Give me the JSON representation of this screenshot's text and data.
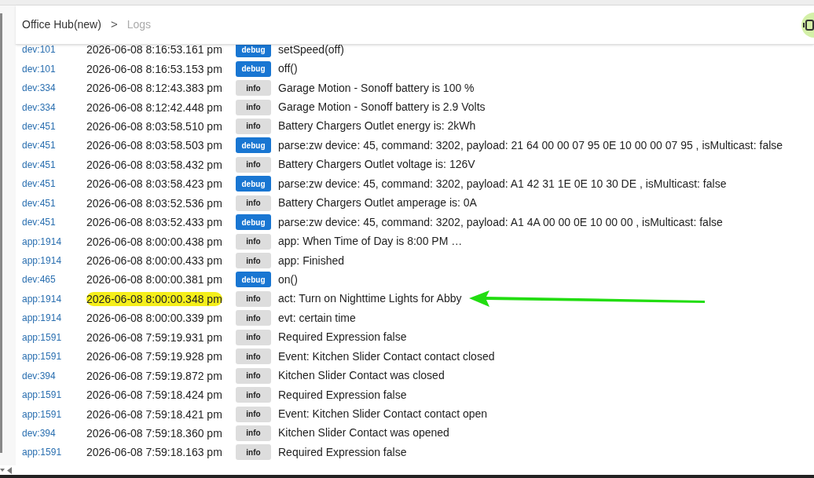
{
  "breadcrumb": {
    "hub": "Office Hub(new)",
    "separator": ">",
    "page": "Logs"
  },
  "rows": [
    {
      "source": "dev:101",
      "time": "2026-06-08 8:16:53.161 pm",
      "kind": "debug",
      "badge": "debug",
      "message": "setSpeed(off)",
      "annotated": false
    },
    {
      "source": "dev:101",
      "time": "2026-06-08 8:16:53.153 pm",
      "kind": "debug",
      "badge": "debug",
      "message": "off()",
      "annotated": false
    },
    {
      "source": "dev:334",
      "time": "2026-06-08 8:12:43.383 pm",
      "kind": "info",
      "badge": "info",
      "message": "Garage Motion - Sonoff battery is 100 %",
      "annotated": false
    },
    {
      "source": "dev:334",
      "time": "2026-06-08 8:12:42.448 pm",
      "kind": "info",
      "badge": "info",
      "message": "Garage Motion - Sonoff battery is 2.9 Volts",
      "annotated": false
    },
    {
      "source": "dev:451",
      "time": "2026-06-08 8:03:58.510 pm",
      "kind": "info",
      "badge": "info",
      "message": "Battery Chargers Outlet energy is: 2kWh",
      "annotated": false
    },
    {
      "source": "dev:451",
      "time": "2026-06-08 8:03:58.503 pm",
      "kind": "debug",
      "badge": "debug",
      "message": "parse:zw device: 45, command: 3202, payload: 21 64 00 00 07 95 0E 10 00 00 07 95 , isMulticast: false",
      "annotated": false
    },
    {
      "source": "dev:451",
      "time": "2026-06-08 8:03:58.432 pm",
      "kind": "info",
      "badge": "info",
      "message": "Battery Chargers Outlet voltage is: 126V",
      "annotated": false
    },
    {
      "source": "dev:451",
      "time": "2026-06-08 8:03:58.423 pm",
      "kind": "debug",
      "badge": "debug",
      "message": "parse:zw device: 45, command: 3202, payload: A1 42 31 1E 0E 10 30 DE , isMulticast: false",
      "annotated": false
    },
    {
      "source": "dev:451",
      "time": "2026-06-08 8:03:52.536 pm",
      "kind": "info",
      "badge": "info",
      "message": "Battery Chargers Outlet amperage is: 0A",
      "annotated": false
    },
    {
      "source": "dev:451",
      "time": "2026-06-08 8:03:52.433 pm",
      "kind": "debug",
      "badge": "debug",
      "message": "parse:zw device: 45, command: 3202, payload: A1 4A 00 00 0E 10 00 00 , isMulticast: false",
      "annotated": false
    },
    {
      "source": "app:1914",
      "time": "2026-06-08 8:00:00.438 pm",
      "kind": "info",
      "badge": "info",
      "message": "app: When Time of Day is 8:00 PM …",
      "annotated": false
    },
    {
      "source": "app:1914",
      "time": "2026-06-08 8:00:00.433 pm",
      "kind": "info",
      "badge": "info",
      "message": "app: Finished",
      "annotated": false
    },
    {
      "source": "dev:465",
      "time": "2026-06-08 8:00:00.381 pm",
      "kind": "debug",
      "badge": "debug",
      "message": "on()",
      "annotated": false
    },
    {
      "source": "app:1914",
      "time": "2026-06-08 8:00:00.348 pm",
      "kind": "info",
      "badge": "info",
      "message": "act: Turn on Nighttime Lights for Abby",
      "annotated": true
    },
    {
      "source": "app:1914",
      "time": "2026-06-08 8:00:00.339 pm",
      "kind": "info",
      "badge": "info",
      "message": "evt: certain time",
      "annotated": false
    },
    {
      "source": "app:1591",
      "time": "2026-06-08 7:59:19.931 pm",
      "kind": "info",
      "badge": "info",
      "message": "Required Expression false",
      "annotated": false
    },
    {
      "source": "app:1591",
      "time": "2026-06-08 7:59:19.928 pm",
      "kind": "info",
      "badge": "info",
      "message": "Event: Kitchen Slider Contact contact closed",
      "annotated": false
    },
    {
      "source": "dev:394",
      "time": "2026-06-08 7:59:19.872 pm",
      "kind": "info",
      "badge": "info",
      "message": "Kitchen Slider Contact was closed",
      "annotated": false
    },
    {
      "source": "app:1591",
      "time": "2026-06-08 7:59:18.424 pm",
      "kind": "info",
      "badge": "info",
      "message": "Required Expression false",
      "annotated": false
    },
    {
      "source": "app:1591",
      "time": "2026-06-08 7:59:18.421 pm",
      "kind": "info",
      "badge": "info",
      "message": "Event: Kitchen Slider Contact contact open",
      "annotated": false
    },
    {
      "source": "dev:394",
      "time": "2026-06-08 7:59:18.360 pm",
      "kind": "info",
      "badge": "info",
      "message": "Kitchen Slider Contact was opened",
      "annotated": false
    },
    {
      "source": "app:1591",
      "time": "2026-06-08 7:59:18.163 pm",
      "kind": "info",
      "badge": "info",
      "message": "Required Expression false",
      "annotated": false
    }
  ]
}
